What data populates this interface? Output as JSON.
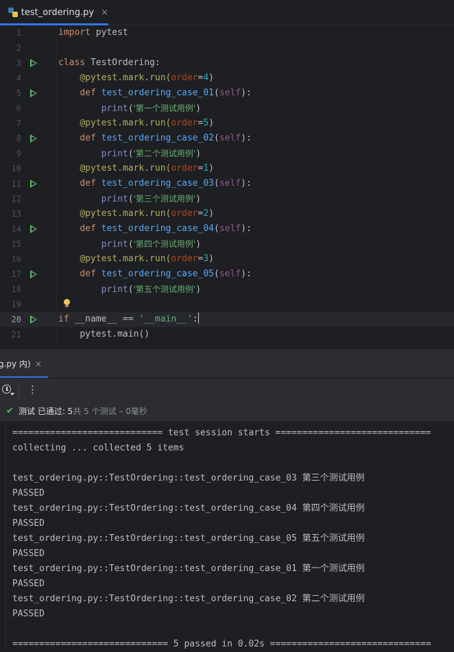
{
  "editor_tab": {
    "filename": "test_ordering.py",
    "close_glyph": "×"
  },
  "editor": {
    "line_numbers": [
      "1",
      "2",
      "3",
      "4",
      "5",
      "6",
      "7",
      "8",
      "9",
      "10",
      "11",
      "12",
      "13",
      "14",
      "15",
      "16",
      "17",
      "18",
      "19",
      "20",
      "21"
    ],
    "current_line": "20",
    "code": {
      "l1": {
        "kw": "import",
        "rest": " pytest"
      },
      "l3": {
        "kw": "class",
        "name": " TestOrdering:"
      },
      "dec_prefix": "@pytest.mark.run(",
      "order_kw": "order",
      "eq": "=",
      "close_paren": ")",
      "def_kw": "def",
      "self_kw": "self",
      "print_fn": "print",
      "orders": [
        "4",
        "5",
        "1",
        "2",
        "3"
      ],
      "funcs": [
        "test_ordering_case_01",
        "test_ordering_case_02",
        "test_ordering_case_03",
        "test_ordering_case_04",
        "test_ordering_case_05"
      ],
      "strings": [
        "'第一个测试用例'",
        "'第二个测试用例'",
        "'第三个测试用例'",
        "'第四个测试用例'",
        "'第五个测试用例'"
      ],
      "l20": {
        "kw": "if",
        "mid": " __name__ == ",
        "str": "'__main__'",
        "colon": ":"
      },
      "l21": "pytest.main()"
    }
  },
  "run_tab": {
    "label": "g.py 内)",
    "close_glyph": "×"
  },
  "toolbar": {
    "more_glyph": "⋮"
  },
  "status": {
    "check_glyph": "✔",
    "label": "测试 已通过: 5",
    "detail": "共 5 个测试 – 0毫秒"
  },
  "console": {
    "lines": [
      "============================ test session starts =============================",
      "collecting ... collected 5 items",
      "",
      "test_ordering.py::TestOrdering::test_ordering_case_03 第三个测试用例",
      "PASSED",
      "test_ordering.py::TestOrdering::test_ordering_case_04 第四个测试用例",
      "PASSED",
      "test_ordering.py::TestOrdering::test_ordering_case_05 第五个测试用例",
      "PASSED",
      "test_ordering.py::TestOrdering::test_ordering_case_01 第一个测试用例",
      "PASSED",
      "test_ordering.py::TestOrdering::test_ordering_case_02 第二个测试用例",
      "PASSED",
      "",
      "============================= 5 passed in 0.02s =============================="
    ]
  }
}
